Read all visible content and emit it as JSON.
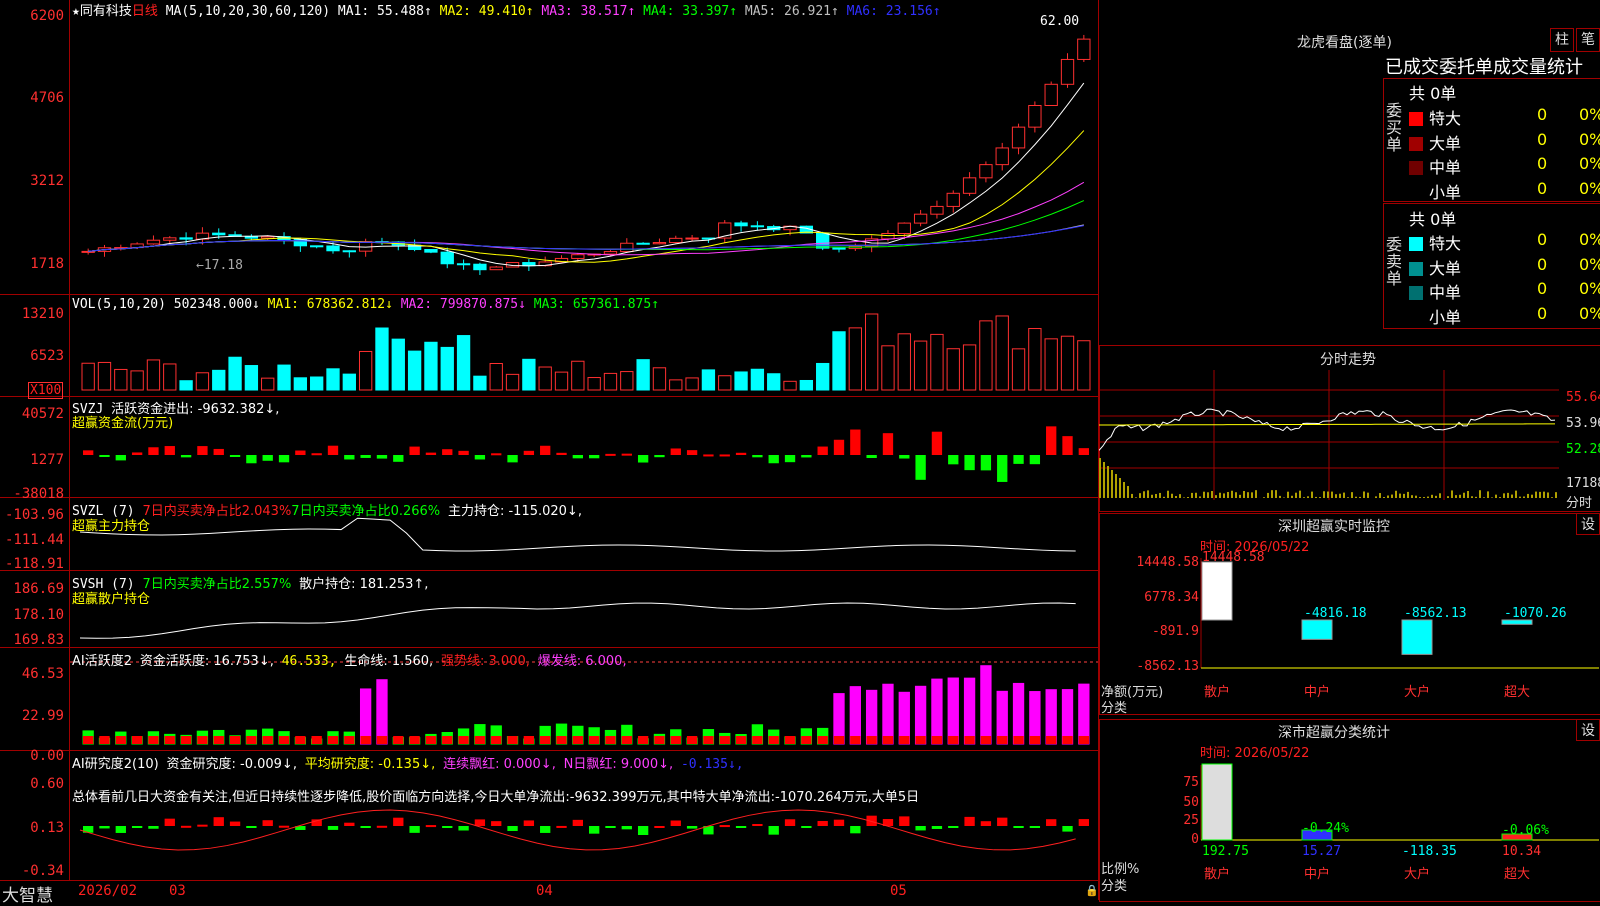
{
  "stock": {
    "star": "★",
    "name": "同有科技",
    "period": "日线"
  },
  "price_panel": {
    "ma_header": "MA(5,10,20,30,60,120)",
    "ma_values": [
      {
        "label": "MA1: 55.488↑",
        "color": "#ffffff"
      },
      {
        "label": "MA2: 49.410↑",
        "color": "#ffff00"
      },
      {
        "label": "MA3: 38.517↑",
        "color": "#ff40ff"
      },
      {
        "label": "MA4: 33.397↑",
        "color": "#00ff00"
      },
      {
        "label": "MA5: 26.921↑",
        "color": "#c0c0c0"
      },
      {
        "label": "MA6: 23.156↑",
        "color": "#3030ff"
      }
    ],
    "y_ticks": [
      "6200",
      "4706",
      "3212",
      "1718"
    ],
    "high_label": "62.00",
    "low_label": "←17.18"
  },
  "vol_panel": {
    "name": "VOL(5,10,20)",
    "value": "502348.000↓",
    "ma1": "MA1: 678362.812↓",
    "ma2": "MA2: 799870.875↓",
    "ma3": "MA3: 657361.875↑",
    "y_ticks": [
      "13210",
      "6523"
    ],
    "unit": "X100"
  },
  "svzj_panel": {
    "name": "SVZJ",
    "line1": "活跃资金进出: -9632.382↓,",
    "line2": "超赢资金流(万元)",
    "y_ticks": [
      "40572",
      "1277",
      "-38018"
    ]
  },
  "svzl_panel": {
    "name": "SVZL (7)",
    "t1": "7日内买卖净占比2.043%",
    "t2": "7日内买卖净占比0.266%",
    "t3": "主力持仓: -115.020↓,",
    "line2": "超赢主力持仓",
    "y_ticks": [
      "-103.96",
      "-111.44",
      "-118.91"
    ]
  },
  "svsh_panel": {
    "name": "SVSH (7)",
    "t1": "7日内买卖净占比2.557%",
    "t2": "散户持仓: 181.253↑,",
    "line2": "超赢散户持仓",
    "y_ticks": [
      "186.69",
      "178.10",
      "169.83"
    ]
  },
  "ai_active": {
    "name": "AI活跃度2",
    "t1": "资金活跃度: 16.753↓,",
    "t2": "46.533,",
    "t3": "生命线: 1.560,",
    "t4": "强势线: 3.000,",
    "t5": "爆发线: 6.000,",
    "y_ticks": [
      "46.53",
      "22.99",
      "0.00"
    ]
  },
  "ai_research": {
    "name": "AI研究度2(10)",
    "t1": "资金研究度: -0.009↓,",
    "t2": "平均研究度: -0.135↓,",
    "t3": "连续飘红: 0.000↓,",
    "t4": "N日飘红: 9.000↓,",
    "t5": "-0.135↓,",
    "comment": "总体看前几日大资金有关注,但近日持续性逐步降低,股价面临方向选择,今日大单净流出:-9632.399万元,其中特大单净流出:-1070.264万元,大单5日",
    "y_ticks": [
      "0.60",
      "0.13",
      "-0.34"
    ]
  },
  "x_axis": {
    "brand": "大智慧",
    "labels": [
      "2026/02",
      "03",
      "04",
      "05"
    ]
  },
  "longhu": {
    "title": "龙虎看盘(逐单)",
    "btn1": "柱",
    "btn2": "笔",
    "subtitle": "已成交委托单成交量统计",
    "buy": {
      "side": "委买单",
      "total": "共 0单",
      "rows": [
        {
          "name": "特大",
          "v": "0",
          "p": "0%",
          "color": "#ff0000"
        },
        {
          "name": "大单",
          "v": "0",
          "p": "0%",
          "color": "#a00000"
        },
        {
          "name": "中单",
          "v": "0",
          "p": "0%",
          "color": "#700000"
        },
        {
          "name": "小单",
          "v": "0",
          "p": "0%",
          "color": "#000000"
        }
      ]
    },
    "sell": {
      "side": "委卖单",
      "total": "共 0单",
      "rows": [
        {
          "name": "特大",
          "v": "0",
          "p": "0%",
          "color": "#00ffff"
        },
        {
          "name": "大单",
          "v": "0",
          "p": "0%",
          "color": "#009090"
        },
        {
          "name": "中单",
          "v": "0",
          "p": "0%",
          "color": "#007070"
        },
        {
          "name": "小单",
          "v": "0",
          "p": "0%",
          "color": "#000000"
        }
      ]
    }
  },
  "intraday": {
    "title": "分时走势",
    "prices": [
      "55.64",
      "53.96",
      "52.28"
    ],
    "vol_label": "17188",
    "vol_unit": "分时"
  },
  "sz_monitor": {
    "title": "深圳超赢实时监控",
    "btn": "设",
    "time": "时间: 2026/05/22",
    "y_ticks": [
      "14448.58",
      "6778.34",
      "-891.9",
      "-8562.13"
    ],
    "ylabel": "净额(万元)",
    "xlabel": "分类",
    "categories": [
      "散户",
      "中户",
      "大户",
      "超大"
    ],
    "values": [
      14448.58,
      -4816.18,
      -8562.13,
      -1070.26
    ],
    "value_labels": [
      "14448.58",
      "-4816.18",
      "-8562.13",
      "-1070.26"
    ]
  },
  "sz_class": {
    "title": "深市超赢分类统计",
    "btn": "设",
    "time": "时间: 2026/05/22",
    "y_ticks": [
      "75",
      "50",
      "25",
      "0"
    ],
    "ylabel": "比例%",
    "xlabel": "分类",
    "categories": [
      "散户",
      "中户",
      "大户",
      "超大"
    ],
    "pct_labels": [
      "",
      "-0.24%",
      "",
      "-0.06%"
    ],
    "values": [
      "192.75",
      "15.27",
      "-118.35",
      "10.34"
    ]
  }
}
